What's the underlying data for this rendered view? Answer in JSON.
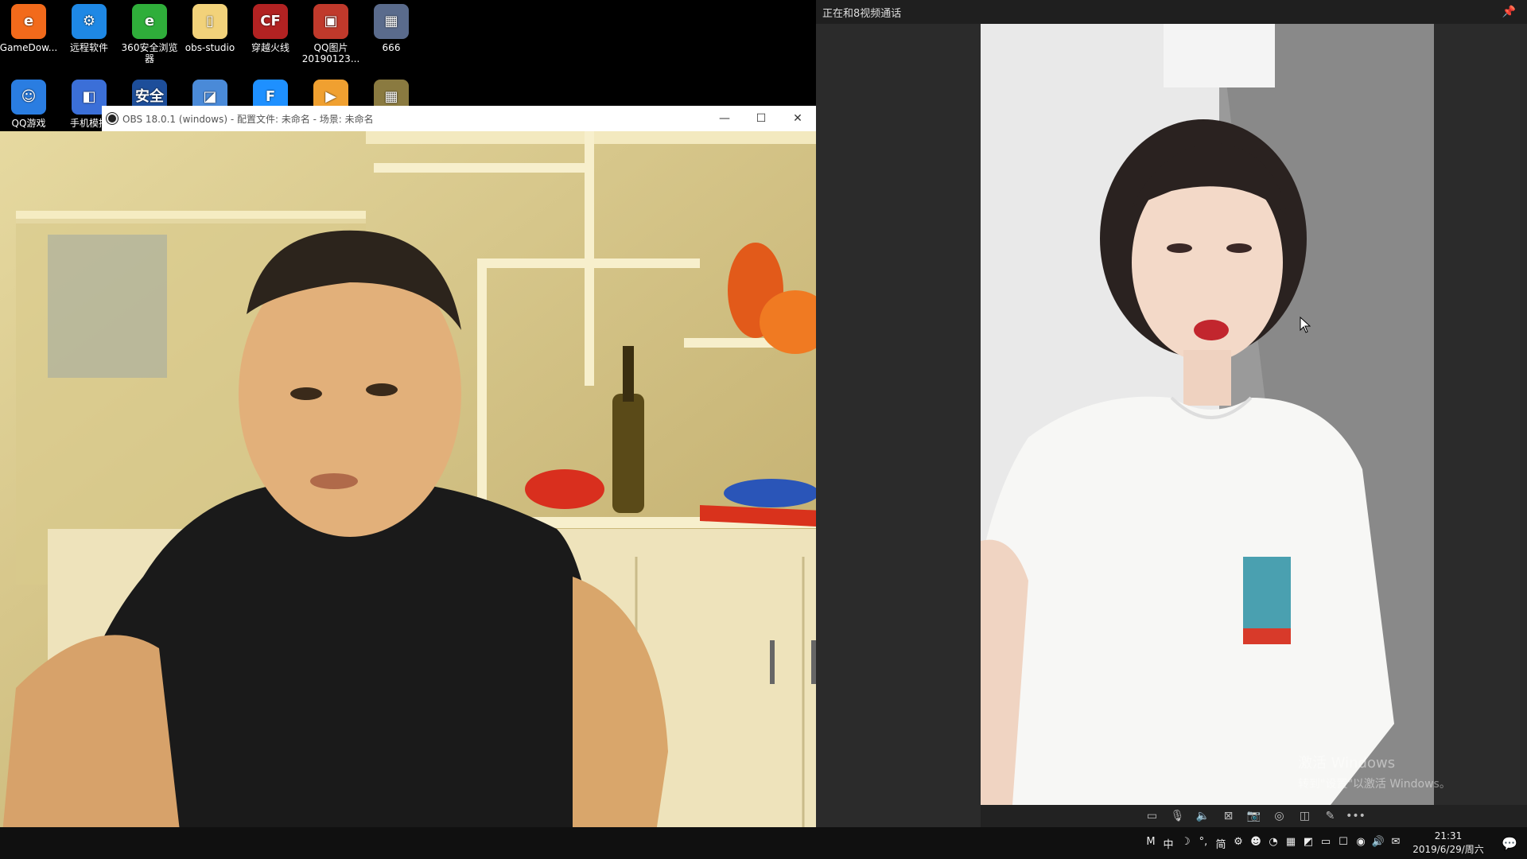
{
  "desktop": {
    "icons": [
      {
        "label": "GameDow...",
        "color": "#f26a1b",
        "glyph": "e"
      },
      {
        "label": "远程软件",
        "color": "#1e88e5",
        "glyph": "⚙"
      },
      {
        "label": "360安全浏览\n器",
        "color": "#2fae3a",
        "glyph": "e"
      },
      {
        "label": "obs-studio",
        "color": "#f2d27a",
        "glyph": "▯"
      },
      {
        "label": "穿越火线",
        "color": "#b22222",
        "glyph": "CF"
      },
      {
        "label": "QQ图片\n20190123...",
        "color": "#c0392b",
        "glyph": "▣"
      },
      {
        "label": "666",
        "color": "#5a6b8c",
        "glyph": "▦"
      },
      {
        "label": "QQ游戏",
        "color": "#2a7de1",
        "glyph": "☺"
      },
      {
        "label": "手机模拟",
        "color": "#3b6fd8",
        "glyph": "◧"
      },
      {
        "label": "",
        "color": "#1d4e9a",
        "glyph": "安全"
      },
      {
        "label": "",
        "color": "#4a8ad8",
        "glyph": "◪"
      },
      {
        "label": "",
        "color": "#1e90ff",
        "glyph": "F"
      },
      {
        "label": "",
        "color": "#f0a030",
        "glyph": "▶"
      },
      {
        "label": "",
        "color": "#8a7a40",
        "glyph": "▦"
      }
    ]
  },
  "obs": {
    "title": "OBS 18.0.1 (windows) - 配置文件: 未命名 - 场景: 未命名",
    "minimize": "—",
    "maximize": "☐",
    "close": "✕"
  },
  "call": {
    "header": "正在和8视频通话",
    "pin_icon": "📌",
    "toolbar_icons": [
      "▭",
      "🎙",
      "🔈",
      "⊠",
      "📷",
      "◎",
      "◫",
      "✎",
      "•••"
    ]
  },
  "watermark": {
    "line1": "激活 Windows",
    "line2": "转到\"设置\"以激活 Windows。"
  },
  "taskbar": {
    "tray_icons": [
      "M",
      "中",
      "☽",
      "°,",
      "简",
      "⚙",
      "☻",
      "◔",
      "▦",
      "◩",
      "▭",
      "☐",
      "◉",
      "🔊",
      "✉"
    ],
    "time": "21:31",
    "date": "2019/6/29/周六",
    "notification_icon": "💬"
  }
}
